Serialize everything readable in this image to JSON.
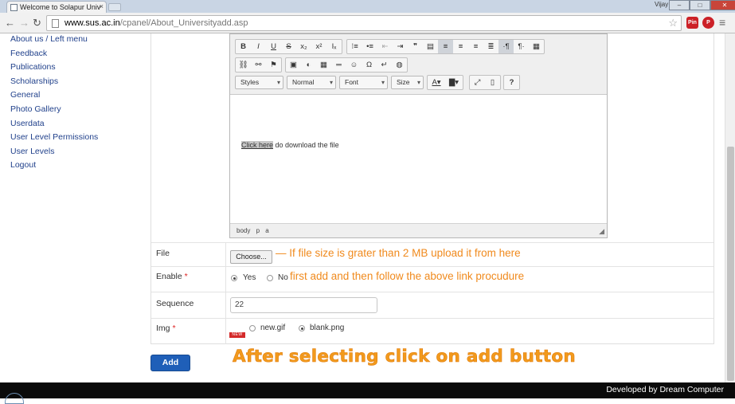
{
  "browser": {
    "tab_title": "Welcome to Solapur Univ",
    "tab_close": "×",
    "user": "Vijay",
    "url_host": "www.sus.ac.in",
    "url_path": "/cpanel/About_Universityadd.asp",
    "ext_pin_label": "Pin"
  },
  "sidebar": {
    "items": [
      {
        "label": "About us / Left menu"
      },
      {
        "label": "Feedback"
      },
      {
        "label": "Publications"
      },
      {
        "label": "Scholarships"
      },
      {
        "label": "General"
      },
      {
        "label": "Photo Gallery"
      },
      {
        "label": "Userdata"
      },
      {
        "label": "User Level Permissions"
      },
      {
        "label": "User Levels"
      },
      {
        "label": "Logout"
      }
    ]
  },
  "editor": {
    "combos": {
      "styles": "Styles",
      "format": "Normal",
      "font": "Font",
      "size": "Size"
    },
    "content_link": "Click here",
    "content_rest": " do download the file",
    "status_path": "body p a"
  },
  "form": {
    "file": {
      "label": "File",
      "button": "Choose...",
      "note": "If file size is grater than 2 MB upload it from here"
    },
    "enable": {
      "label": "Enable",
      "required_mark": "*",
      "options": [
        "Yes",
        "No"
      ],
      "selected": "Yes",
      "note": "first add and then follow the above link procudure"
    },
    "sequence": {
      "label": "Sequence",
      "value": "22"
    },
    "img": {
      "label": "Img",
      "required_mark": "*",
      "options": [
        "new.gif",
        "blank.png"
      ],
      "selected": "blank.png",
      "badge": "NEW"
    },
    "add_button": "Add"
  },
  "instruction": "After selecting click on add button",
  "footer": {
    "text": "Developed by Dream Computer"
  },
  "colors": {
    "note": "#f08a1d",
    "add_button": "#1f5fb8",
    "link": "#22428c"
  }
}
